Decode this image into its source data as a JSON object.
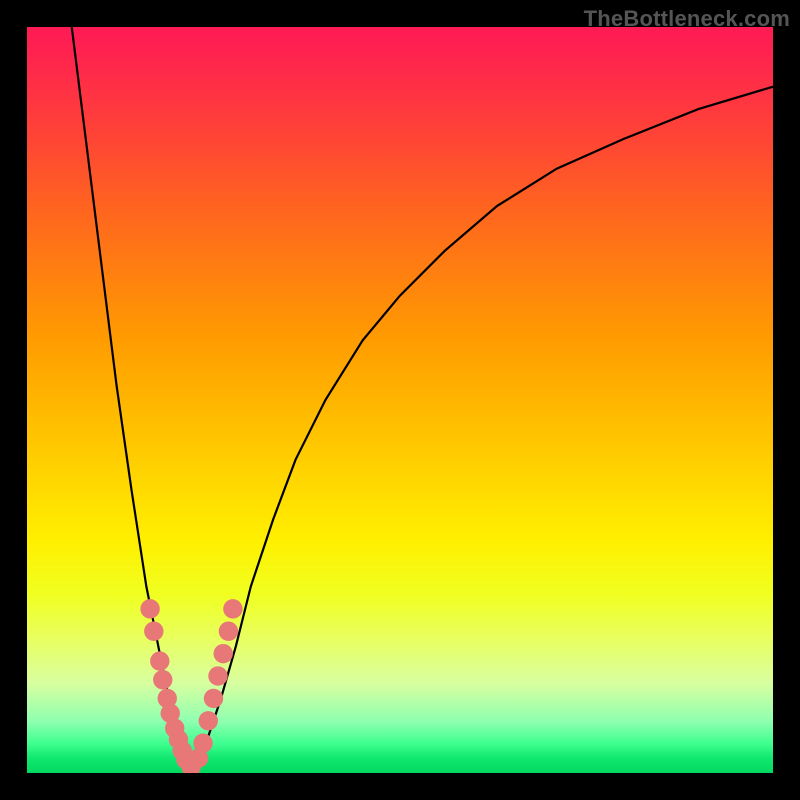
{
  "watermark": "TheBottleneck.com",
  "chart_data": {
    "type": "line",
    "title": "",
    "xlabel": "",
    "ylabel": "",
    "xlim": [
      0,
      100
    ],
    "ylim": [
      0,
      100
    ],
    "grid": false,
    "background_gradient": {
      "orientation": "vertical",
      "stops": [
        {
          "pos": 0,
          "color": "#ff1a55"
        },
        {
          "pos": 50,
          "color": "#ffc800"
        },
        {
          "pos": 75,
          "color": "#fff000"
        },
        {
          "pos": 100,
          "color": "#00d860"
        }
      ]
    },
    "series": [
      {
        "name": "left-curve",
        "x": [
          6,
          8,
          10,
          12,
          14,
          16,
          17,
          18,
          19,
          20,
          21,
          22
        ],
        "y": [
          100,
          84,
          68,
          52,
          38,
          25,
          20,
          15,
          10,
          6,
          3,
          0
        ]
      },
      {
        "name": "right-curve",
        "x": [
          22,
          24,
          26,
          28,
          30,
          33,
          36,
          40,
          45,
          50,
          56,
          63,
          71,
          80,
          90,
          100
        ],
        "y": [
          0,
          4,
          10,
          17,
          25,
          34,
          42,
          50,
          58,
          64,
          70,
          76,
          81,
          85,
          89,
          92
        ]
      }
    ],
    "markers": {
      "name": "data-points",
      "color": "#e87878",
      "radius": 1.3,
      "points": [
        {
          "x": 16.5,
          "y": 22
        },
        {
          "x": 17.0,
          "y": 19
        },
        {
          "x": 17.8,
          "y": 15
        },
        {
          "x": 18.2,
          "y": 12.5
        },
        {
          "x": 18.8,
          "y": 10
        },
        {
          "x": 19.2,
          "y": 8
        },
        {
          "x": 19.8,
          "y": 6
        },
        {
          "x": 20.3,
          "y": 4.5
        },
        {
          "x": 20.8,
          "y": 3
        },
        {
          "x": 21.3,
          "y": 1.8
        },
        {
          "x": 22.0,
          "y": 0.8
        },
        {
          "x": 23.0,
          "y": 2
        },
        {
          "x": 23.6,
          "y": 4
        },
        {
          "x": 24.3,
          "y": 7
        },
        {
          "x": 25.0,
          "y": 10
        },
        {
          "x": 25.6,
          "y": 13
        },
        {
          "x": 26.3,
          "y": 16
        },
        {
          "x": 27.0,
          "y": 19
        },
        {
          "x": 27.6,
          "y": 22
        }
      ]
    }
  }
}
